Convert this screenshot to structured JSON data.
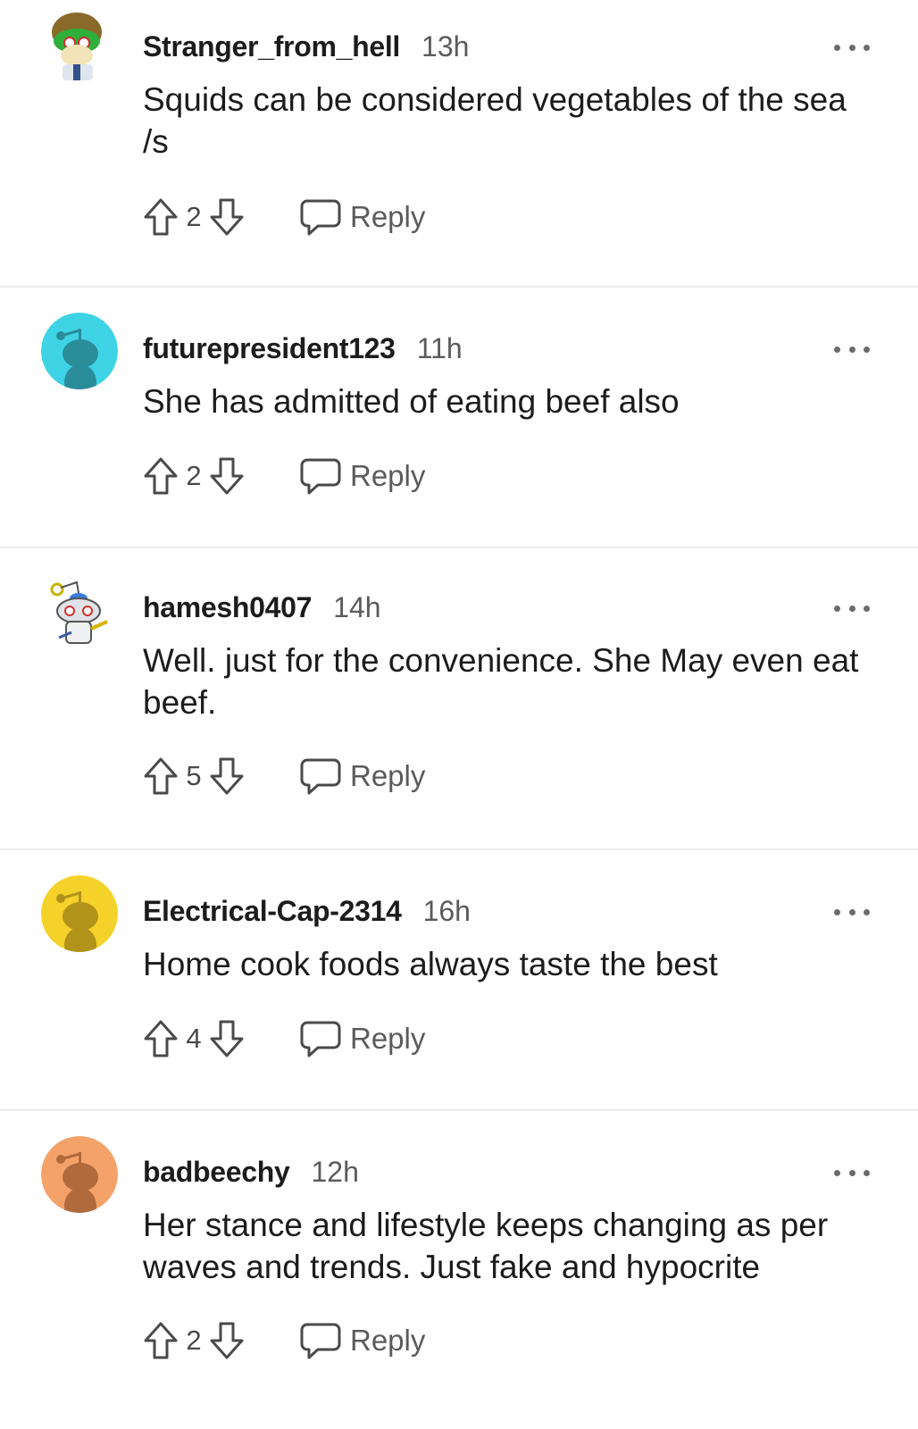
{
  "comments": [
    {
      "username": "Stranger_from_hell",
      "time": "13h",
      "body": "Squids can be considered vegetables of the sea /s",
      "score": "2",
      "reply_label": "Reply",
      "avatar_icon": "snoo-avatar-helmet-icon",
      "avatar_color": "#ffffff"
    },
    {
      "username": "futurepresident123",
      "time": "11h",
      "body": "She has admitted of eating beef also",
      "score": "2",
      "reply_label": "Reply",
      "avatar_icon": "snoo-silhouette-icon",
      "avatar_color": "#3fd3e6"
    },
    {
      "username": "hamesh0407",
      "time": "14h",
      "body": "Well. just for the convenience. She May even eat beef.",
      "score": "5",
      "reply_label": "Reply",
      "avatar_icon": "snoo-avatar-robot-icon",
      "avatar_color": "#ffffff"
    },
    {
      "username": "Electrical-Cap-2314",
      "time": "16h",
      "body": "Home cook foods always taste the best",
      "score": "4",
      "reply_label": "Reply",
      "avatar_icon": "snoo-silhouette-icon",
      "avatar_color": "#f5d22a"
    },
    {
      "username": "badbeechy",
      "time": "12h",
      "body": "Her stance and lifestyle keeps changing as per waves and trends. Just fake and hypocrite",
      "score": "2",
      "reply_label": "Reply",
      "avatar_icon": "snoo-silhouette-icon",
      "avatar_color": "#f4a26a"
    }
  ]
}
